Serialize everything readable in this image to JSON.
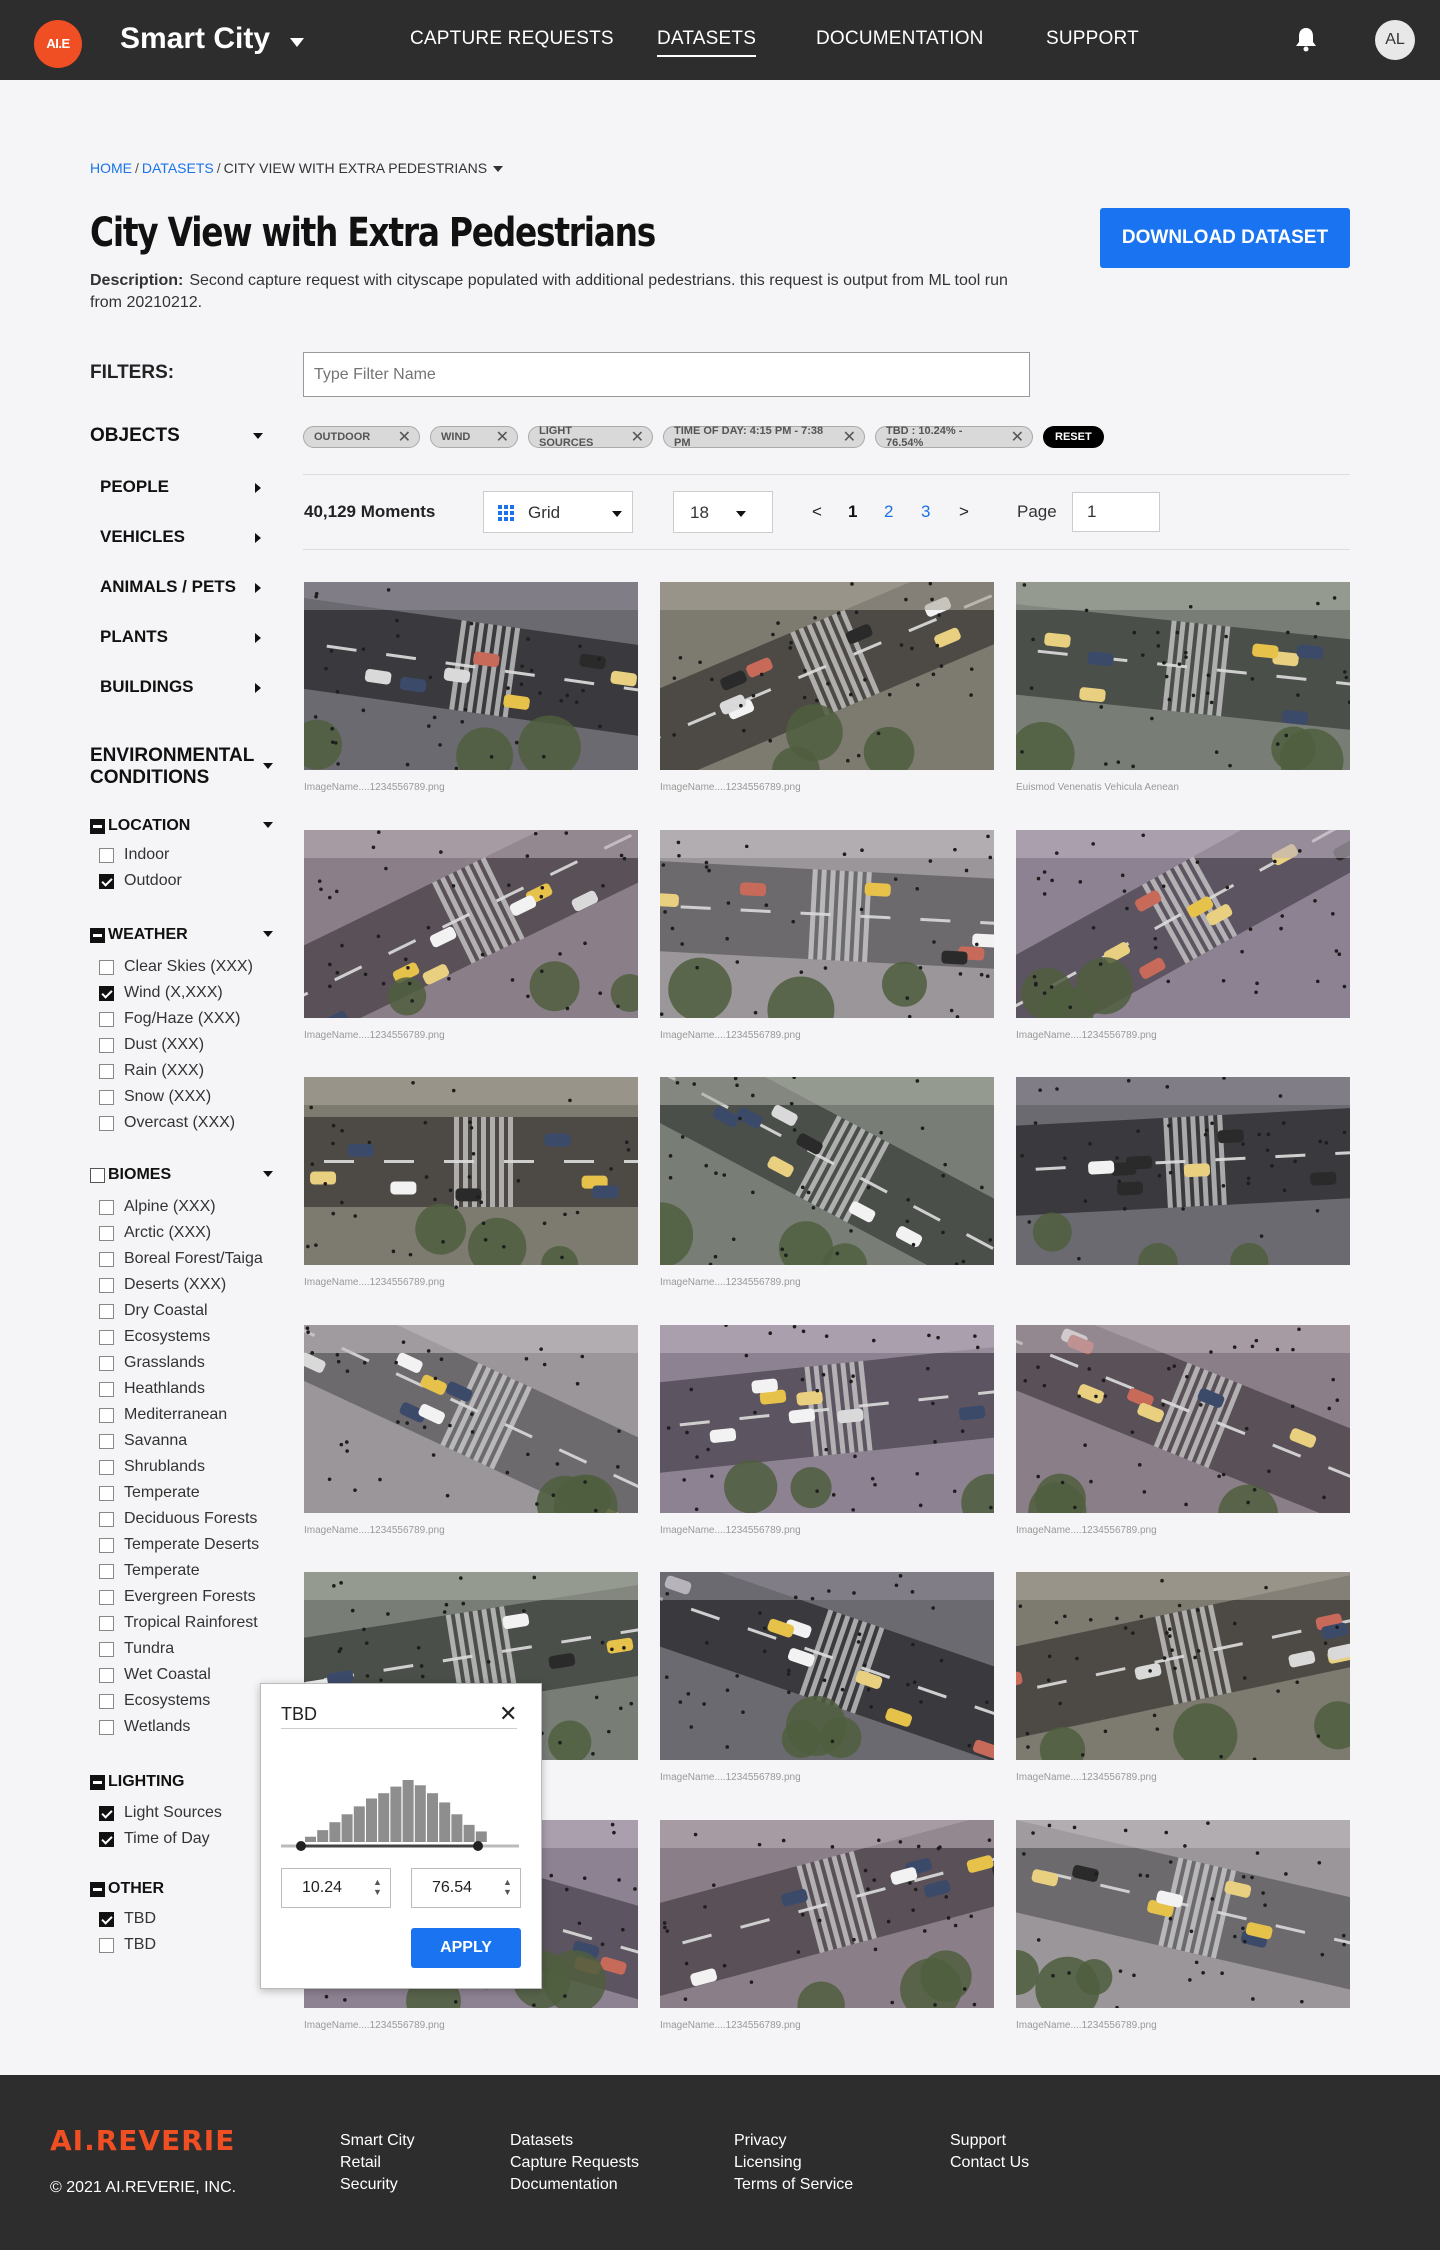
{
  "nav": {
    "logo": "AI.E",
    "app_title": "Smart City",
    "links": [
      "CAPTURE REQUESTS",
      "DATASETS",
      "DOCUMENTATION",
      "SUPPORT"
    ],
    "active_link": "DATASETS",
    "avatar_initials": "AL"
  },
  "breadcrumb": {
    "home": "HOME",
    "datasets": "DATASETS",
    "current": "CITY VIEW WITH EXTRA PEDESTRIANS"
  },
  "header": {
    "title": "City View with Extra Pedestrians",
    "description_label": "Description:",
    "description": "Second capture request with cityscape populated with additional pedestrians. this request is output from ML tool run from 20210212.",
    "download_button": "DOWNLOAD DATASET"
  },
  "filters": {
    "label": "FILTERS:",
    "placeholder": "Type Filter Name",
    "chips": [
      "OUTDOOR",
      "WIND",
      "LIGHT SOURCES",
      "TIME OF DAY: 4:15 PM - 7:38 PM",
      "TBD : 10.24% - 76.54%"
    ],
    "reset": "RESET"
  },
  "sidebar": {
    "objects": {
      "title": "OBJECTS",
      "items": [
        "PEOPLE",
        "VEHICLES",
        "ANIMALS / PETS",
        "PLANTS",
        "BUILDINGS"
      ]
    },
    "environmental": {
      "title_line1": "ENVIRONMENTAL",
      "title_line2": "CONDITIONS"
    },
    "location": {
      "title": "LOCATION",
      "options": [
        {
          "label": "Indoor",
          "checked": false
        },
        {
          "label": "Outdoor",
          "checked": true
        }
      ]
    },
    "weather": {
      "title": "WEATHER",
      "options": [
        {
          "label": "Clear Skies (XXX)",
          "checked": false
        },
        {
          "label": "Wind (X,XXX)",
          "checked": true
        },
        {
          "label": "Fog/Haze (XXX)",
          "checked": false
        },
        {
          "label": "Dust (XXX)",
          "checked": false
        },
        {
          "label": "Rain (XXX)",
          "checked": false
        },
        {
          "label": "Snow (XXX)",
          "checked": false
        },
        {
          "label": "Overcast (XXX)",
          "checked": false
        }
      ]
    },
    "biomes": {
      "title": "BIOMES",
      "options": [
        "Alpine  (XXX)",
        "Arctic  (XXX)",
        "Boreal Forest/Taiga",
        "Deserts (XXX)",
        "Dry Coastal",
        "Ecosystems",
        "Grasslands",
        "Heathlands",
        "Mediterranean",
        "Savanna",
        "Shrublands",
        "Temperate",
        "Deciduous Forests",
        "Temperate Deserts",
        "Temperate",
        "Evergreen Forests",
        "Tropical Rainforest",
        "Tundra",
        "Wet Coastal",
        "Ecosystems",
        "Wetlands"
      ]
    },
    "lighting": {
      "title": "LIGHTING",
      "options": [
        {
          "label": "Light Sources",
          "checked": true
        },
        {
          "label": "Time of Day",
          "checked": true
        }
      ]
    },
    "other": {
      "title": "OTHER",
      "options": [
        {
          "label": "TBD",
          "checked": true
        },
        {
          "label": "TBD",
          "checked": false
        }
      ]
    }
  },
  "results": {
    "count": "40,129 Moments",
    "view_mode": "Grid",
    "per_page": "18",
    "prev": "<",
    "next": ">",
    "pages": [
      "1",
      "2",
      "3"
    ],
    "current_page_label": "Page",
    "page_value": "1",
    "captions": [
      "ImageName....1234556789.png",
      "ImageName....1234556789.png",
      "Euismod Venenatis Vehicula Aenean",
      "ImageName....1234556789.png",
      "ImageName....1234556789.png",
      "ImageName....1234556789.png",
      "ImageName....1234556789.png",
      "ImageName....1234556789.png",
      "",
      "ImageName....1234556789.png",
      "ImageName....1234556789.png",
      "ImageName....1234556789.png",
      "",
      "ImageName....1234556789.png",
      "ImageName....1234556789.png",
      "ImageName....1234556789.png",
      "ImageName....1234556789.png",
      "ImageName....1234556789.png"
    ]
  },
  "popover": {
    "title": "TBD",
    "histogram": [
      4,
      9,
      15,
      21,
      27,
      33,
      37,
      42,
      47,
      43,
      37,
      30,
      21,
      13,
      8
    ],
    "min_value": "10.24",
    "max_value": "76.54",
    "apply": "APPLY"
  },
  "footer": {
    "logo": "AI.REVERIE",
    "copyright": "© 2021 AI.REVERIE, INC.",
    "col1": [
      "Smart City",
      "Retail",
      "Security"
    ],
    "col2": [
      "Datasets",
      "Capture Requests",
      "Documentation"
    ],
    "col3": [
      "Privacy",
      "Licensing",
      "Terms of Service"
    ],
    "col4": [
      "Support",
      "Contact Us"
    ]
  },
  "colors": {
    "brand_orange": "#f04e23",
    "primary_blue": "#1a73f0",
    "link_blue": "#1a73e8",
    "dark_bar": "#2d2d2d"
  }
}
